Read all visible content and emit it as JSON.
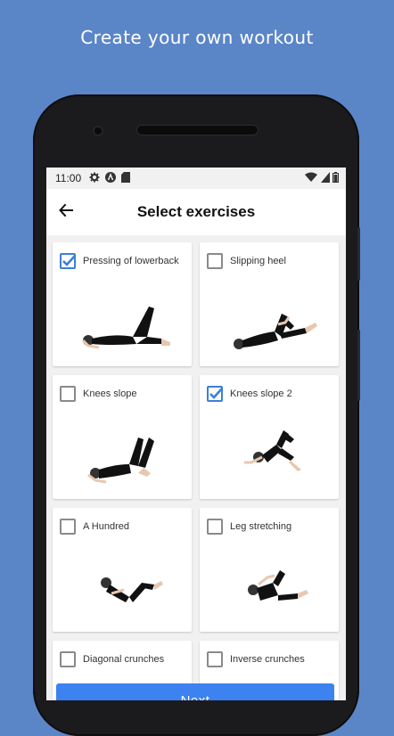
{
  "promo": {
    "title": "Create your own workout"
  },
  "status_bar": {
    "time": "11:00",
    "icons": [
      "gear-icon",
      "a-icon",
      "sd-card-icon",
      "wifi-icon",
      "battery-icon"
    ]
  },
  "app_bar": {
    "title": "Select exercises",
    "back_icon": "arrow-left-icon"
  },
  "exercises": [
    {
      "name": "Pressing of lowerback",
      "checked": true
    },
    {
      "name": "Slipping heel",
      "checked": false
    },
    {
      "name": "Knees slope",
      "checked": false
    },
    {
      "name": "Knees slope 2",
      "checked": true
    },
    {
      "name": "A Hundred",
      "checked": false
    },
    {
      "name": "Leg stretching",
      "checked": false
    },
    {
      "name": "Diagonal crunches",
      "checked": false
    },
    {
      "name": "Inverse crunches",
      "checked": false
    }
  ],
  "next_button": {
    "label": "Next"
  },
  "colors": {
    "background": "#5a86c8",
    "accent": "#3d7fd9",
    "button": "#3c82f0"
  }
}
